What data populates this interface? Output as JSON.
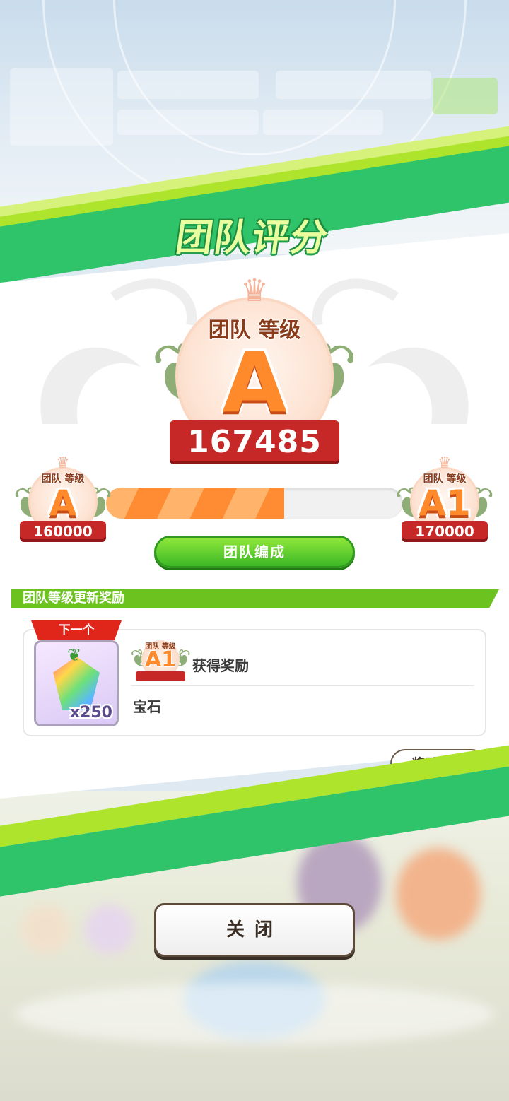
{
  "header": {
    "title": "团队评分"
  },
  "current_rank": {
    "label": "团队 等级",
    "grade": "A",
    "score": "167485"
  },
  "progress": {
    "min_rank": {
      "label": "团队 等级",
      "grade": "A",
      "score": "160000"
    },
    "max_rank": {
      "label": "团队 等级",
      "grade": "A1",
      "score": "170000"
    },
    "fraction": 0.6
  },
  "buttons": {
    "team_formation": "团队编成",
    "reward_list": "奖励一览",
    "close": "关闭"
  },
  "reward_section": {
    "title": "团队等级更新奖励",
    "next_tag": "下一个",
    "item_quantity": "x250",
    "target_rank": {
      "label": "团队 等级",
      "grade": "A1"
    },
    "reward_title": "获得奖励",
    "reward_item": "宝石"
  },
  "colors": {
    "accent_green": "#2fc46a",
    "lime": "#aee52c",
    "progress_orange": "#ff8c33",
    "band_red": "#c62828"
  }
}
